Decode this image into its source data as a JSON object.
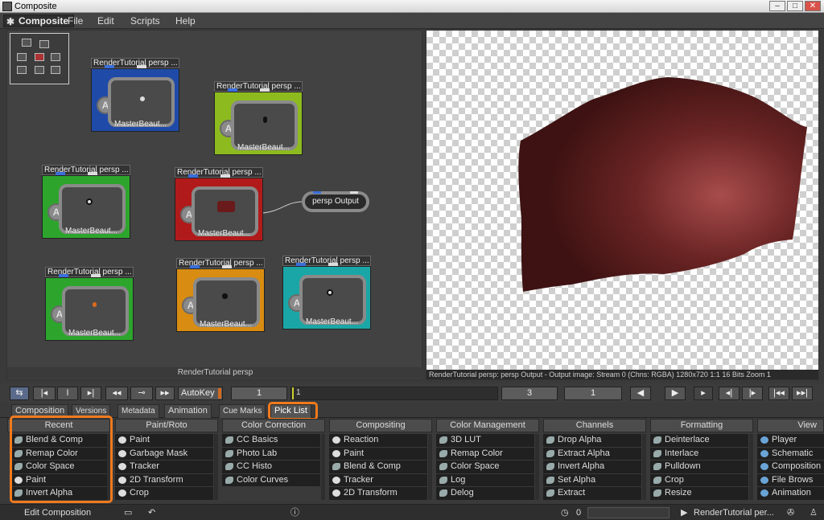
{
  "window": {
    "title": "Composite"
  },
  "menu": {
    "brand": "Composite",
    "items": [
      "File",
      "Edit",
      "Scripts",
      "Help"
    ]
  },
  "graph": {
    "label": "RenderTutorial persp",
    "nodes": [
      {
        "title": "RenderTutorial persp ...",
        "label": "MasterBeaut...",
        "color": "blue"
      },
      {
        "title": "RenderTutorial persp ...",
        "label": "MasterBeaut...",
        "color": "lime"
      },
      {
        "title": "RenderTutorial persp ...",
        "label": "MasterBeaut...",
        "color": "green"
      },
      {
        "title": "RenderTutorial persp ...",
        "label": "MasterBeaut...",
        "color": "red"
      },
      {
        "title": "RenderTutorial persp ...",
        "label": "MasterBeaut...",
        "color": "green"
      },
      {
        "title": "RenderTutorial persp ...",
        "label": "MasterBeaut...",
        "color": "orange"
      },
      {
        "title": "RenderTutorial persp ...",
        "label": "MasterBeaut...",
        "color": "teal"
      }
    ],
    "output_node": "persp Output"
  },
  "viewer": {
    "status": "RenderTutorial persp: persp Output - Output image: Stream 0 (Chns: RGBA) 1280x720 1:1 16 Bits Zoom 1"
  },
  "timebar": {
    "autokey": "AutoKey",
    "frame_start": "1",
    "slider_value": "1",
    "frame_current": "3",
    "frame_end": "1",
    "btn_set": "I",
    "btn_transport_pin": "⟳"
  },
  "tabs": [
    "Composition",
    "Versions",
    "Metadata",
    "Animation",
    "Cue Marks",
    "Pick List"
  ],
  "pick_list": {
    "columns": [
      {
        "header": "Recent",
        "items": [
          "Blend & Comp",
          "Remap Color",
          "Color Space",
          "Paint",
          "Invert Alpha"
        ]
      },
      {
        "header": "Paint/Roto",
        "items": [
          "Paint",
          "Garbage Mask",
          "Tracker",
          "2D Transform",
          "Crop"
        ]
      },
      {
        "header": "Color Correction",
        "items": [
          "CC Basics",
          "Photo Lab",
          "CC Histo",
          "Color Curves"
        ]
      },
      {
        "header": "Compositing",
        "items": [
          "Reaction",
          "Paint",
          "Blend & Comp",
          "Tracker",
          "2D Transform"
        ]
      },
      {
        "header": "Color Management",
        "items": [
          "3D LUT",
          "Remap Color",
          "Color Space",
          "Log",
          "Delog"
        ]
      },
      {
        "header": "Channels",
        "items": [
          "Drop Alpha",
          "Extract Alpha",
          "Invert Alpha",
          "Set Alpha",
          "Extract"
        ]
      },
      {
        "header": "Formatting",
        "items": [
          "Deinterlace",
          "Interlace",
          "Pulldown",
          "Crop",
          "Resize"
        ]
      },
      {
        "header": "View",
        "items": [
          "Player",
          "Schematic",
          "Composition",
          "File Brows",
          "Animation"
        ]
      }
    ]
  },
  "statusbar": {
    "left": "Edit Composition",
    "progress_value": "0",
    "render_label": "RenderTutorial per..."
  },
  "colors": {
    "highlight": "#f07a1e",
    "bg": "#3a3a3a"
  }
}
